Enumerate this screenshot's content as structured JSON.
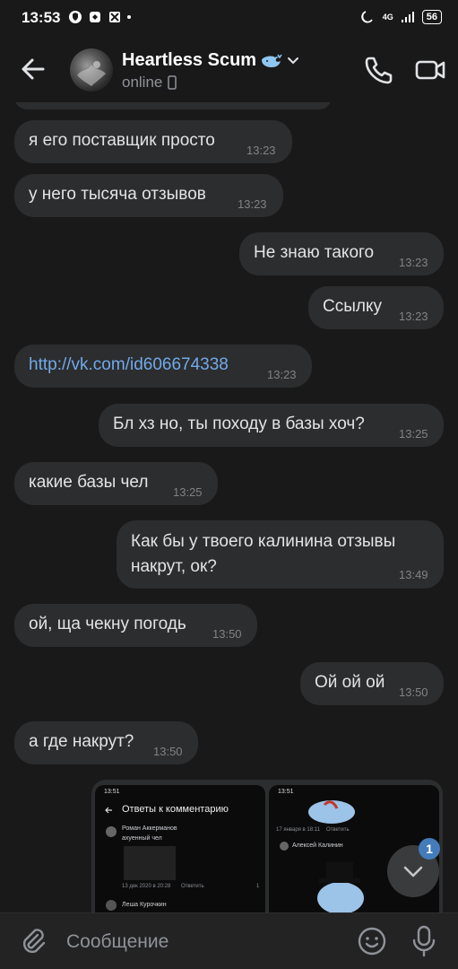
{
  "status_bar": {
    "time": "13:53",
    "network": "4G",
    "battery": "56"
  },
  "header": {
    "contact_name": "Heartless Scum",
    "status": "online"
  },
  "messages": [
    {
      "text": "я его поставщик просто",
      "time": "13:23",
      "side": "in"
    },
    {
      "text": "у него тысяча отзывов",
      "time": "13:23",
      "side": "in"
    },
    {
      "text": "Не знаю такого",
      "time": "13:23",
      "side": "out"
    },
    {
      "text": "Ссылку",
      "time": "13:23",
      "side": "out"
    },
    {
      "text": "http://vk.com/id606674338",
      "time": "13:23",
      "side": "in"
    },
    {
      "text": "Бл хз но, ты походу в базы хоч?",
      "time": "13:25",
      "side": "out"
    },
    {
      "text": "какие базы чел",
      "time": "13:25",
      "side": "in"
    },
    {
      "text": "Как бы у твоего калинина отзывы накрут, ок?",
      "time": "13:49",
      "side": "out"
    },
    {
      "text": "ой, ща чекну погодь",
      "time": "13:50",
      "side": "in"
    },
    {
      "text": "Ой ой ой",
      "time": "13:50",
      "side": "out"
    },
    {
      "text": "а где накрут?",
      "time": "13:50",
      "side": "in"
    }
  ],
  "screenshot1": {
    "time": "13:51",
    "title": "Ответы к комментарию",
    "author": "Роман Аккерманов",
    "comment": "ахуенный чел",
    "date": "13 дек 2020 в 20:28",
    "reply": "Ответить",
    "likes": "1",
    "next_author": "Леша Курочкин"
  },
  "screenshot2": {
    "time": "13:51",
    "date": "17 января в 18:11",
    "reply": "Ответить",
    "author": "Алексей Калинин"
  },
  "unread_badge": "1",
  "input": {
    "placeholder": "Сообщение"
  }
}
